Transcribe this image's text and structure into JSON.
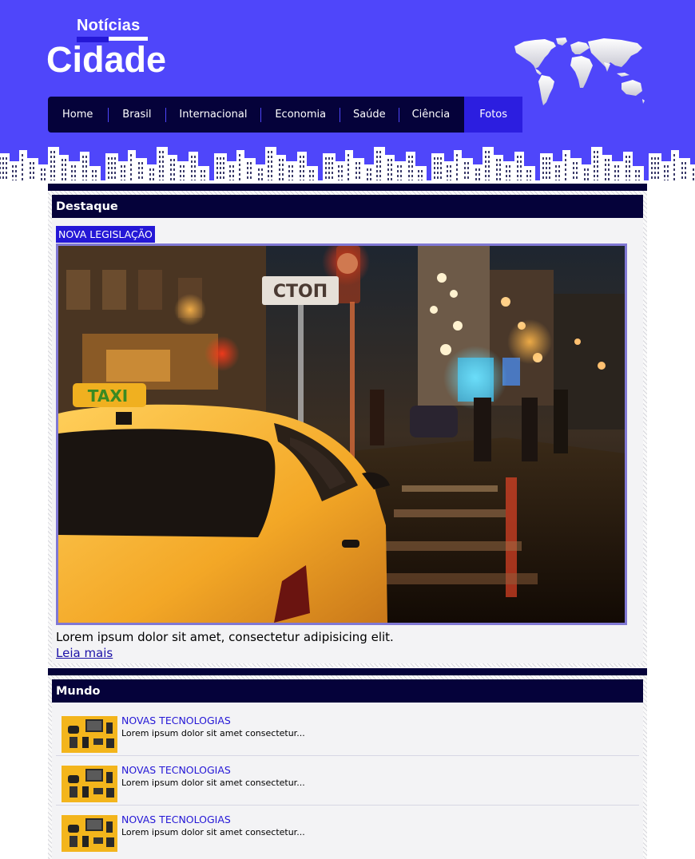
{
  "header": {
    "logo_top": "Notícias",
    "logo_main": "Cidade"
  },
  "nav": {
    "items": [
      {
        "label": "Home"
      },
      {
        "label": "Brasil"
      },
      {
        "label": "Internacional"
      },
      {
        "label": "Economia"
      },
      {
        "label": "Saúde"
      },
      {
        "label": "Ciência"
      },
      {
        "label": "Fotos",
        "active": true
      }
    ]
  },
  "destaque": {
    "title": "Destaque",
    "tag": "NOVA LEGISLAÇÃO",
    "photo": {
      "sign_text": "СТОП",
      "taxi_text": "TAXI"
    },
    "lead": "Lorem ipsum dolor sit amet, consectetur adipisicing elit.",
    "more_link": "Leia mais"
  },
  "mundo": {
    "title": "Mundo",
    "items": [
      {
        "title": "NOVAS TECNOLOGIAS",
        "text": "Lorem ipsum dolor sit amet consectetur..."
      },
      {
        "title": "NOVAS TECNOLOGIAS",
        "text": "Lorem ipsum dolor sit amet consectetur..."
      },
      {
        "title": "NOVAS TECNOLOGIAS",
        "text": "Lorem ipsum dolor sit amet consectetur..."
      }
    ]
  },
  "colors": {
    "header_bg": "#4f46fa",
    "nav_bg": "#05023a",
    "nav_active": "#2c1ee0",
    "accent": "#2417d6",
    "section_title_bg": "#05023a"
  },
  "icons": {
    "world_map": "world-map-icon",
    "skyline": "city-skyline-icon",
    "news_thumb": "tech-gadgets-thumbnail"
  }
}
